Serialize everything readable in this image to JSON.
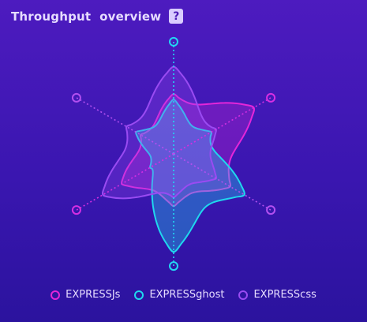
{
  "header": {
    "title": "Throughput  overview",
    "help_icon": "question-mark-icon",
    "help_glyph": "?"
  },
  "colors": {
    "background_top": "#4d1bbf",
    "background_bottom": "#2b139e",
    "axis_vertical": "#22d6f2",
    "axis_diag_a": "#d62ee3",
    "axis_diag_b": "#b24ff0"
  },
  "chart_data": {
    "type": "radar",
    "title": "Throughput  overview",
    "indicators": [
      "",
      "",
      "",
      "",
      "",
      ""
    ],
    "series": [
      {
        "name": "EXPRESSJs",
        "color": "#e426d9",
        "values": [
          0.55,
          0.85,
          0.6,
          0.48,
          0.55,
          0.35
        ]
      },
      {
        "name": "EXPRESSghost",
        "color": "#1fd8ee",
        "values": [
          0.5,
          0.4,
          0.75,
          0.9,
          0.25,
          0.4
        ]
      },
      {
        "name": "EXPRESScss",
        "color": "#9a4bf2",
        "values": [
          0.8,
          0.45,
          0.45,
          0.4,
          0.75,
          0.5
        ]
      }
    ],
    "legend_position": "bottom"
  }
}
